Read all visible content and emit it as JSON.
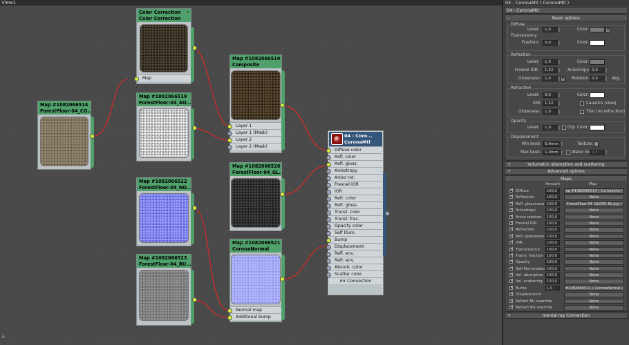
{
  "viewport": {
    "title": "View1"
  },
  "nodes": {
    "cc": {
      "line1": "Color Correction",
      "line2": "Color Correction",
      "slot": "Map"
    },
    "base": {
      "line1": "Map #1082066514",
      "line2": "ForestFloor-04_CO..."
    },
    "ao": {
      "line1": "Map #1082066519",
      "line2": "ForestFloor-04_AO..."
    },
    "nrm": {
      "line1": "Map #1082066522",
      "line2": "ForestFloor-04_NO..."
    },
    "bump": {
      "line1": "Map #1082066523",
      "line2": "ForestFloor-04_BU..."
    },
    "comp": {
      "line1": "Map #1082066514",
      "line2": "Composite",
      "slots": [
        "Layer 1",
        "Layer 1 (Mask)",
        "Layer 2",
        "Layer 2 (Mask)"
      ]
    },
    "gloss": {
      "line1": "Map #1082066520",
      "line2": "ForestFloor-04_GL..."
    },
    "cn": {
      "line1": "Map #1082066521",
      "line2": "CoronaNormal",
      "slots": [
        "Normal map",
        "Additional bump"
      ]
    },
    "mtl": {
      "line1": "04 - Coro...",
      "line2": "CoronaMtl",
      "slots": [
        "Diffuse color",
        "Refl. color",
        "Refl. gloss.",
        "Anisotropy",
        "Aniso rot.",
        "Fresnel IOR",
        "IOR",
        "Refr. color",
        "Refr. gloss.",
        "Transl. color",
        "Transl. frac.",
        "Opacity color",
        "Self Illum.",
        "Bump",
        "Displacement",
        "Refl. env.",
        "Refr. env.",
        "Absorb. color",
        "Scatter color",
        "mr Connection"
      ]
    }
  },
  "panel": {
    "title": "04 - CoronaMtl  ( CoronaMtl )",
    "name": "04 - CoronaMtl",
    "basic": "Basic options",
    "diffuse": {
      "label": "Diffuse",
      "level_lbl": "Level:",
      "level": "1,0",
      "color_lbl": "Color:",
      "m": "M",
      "transl_lbl": "Translucency",
      "fraction_lbl": "Fraction:",
      "fraction": "0,0",
      "color2_lbl": "Color:"
    },
    "reflection": {
      "label": "Reflection",
      "level_lbl": "Level:",
      "level": "1,0",
      "color_lbl": "Color:",
      "fior_lbl": "Fresnel IOR:",
      "fior": "1,52",
      "aniso_lbl": "Anisotropy:",
      "aniso": "0,0",
      "gloss_lbl": "Glossiness:",
      "gloss": "1,0",
      "m": "M",
      "rot_lbl": "Rotation:",
      "rot": "0,0",
      "deg": "deg."
    },
    "refraction": {
      "label": "Refraction",
      "level_lbl": "Level:",
      "level": "0,0",
      "color_lbl": "Color:",
      "ior_lbl": "IOR:",
      "ior": "1,52",
      "caustics": "Caustics (slow)",
      "gloss_lbl": "Glossiness:",
      "gloss": "1,0",
      "thin": "Thin (no refraction)"
    },
    "opacity": {
      "label": "Opacity",
      "level_lbl": "Level:",
      "level": "1,0",
      "clip": "Clip",
      "color_lbl": "Color:"
    },
    "displacement": {
      "label": "Displacement",
      "min_lbl": "Min level:",
      "min": "0,0mm",
      "tex_lbl": "Texture:",
      "max_lbl": "Max level:",
      "max": "1,0mm",
      "water_lbl": "Water lvl:",
      "water": "0,5"
    },
    "vol": "Volumetric absorption and scattering",
    "advanced": "Advanced options",
    "maps": "Maps",
    "amount_hdr": "Amount",
    "map_hdr": "Map",
    "rows": [
      {
        "name": "Diffuse",
        "amount": "100,0",
        "map": "ap #1082066514  ( Composite )"
      },
      {
        "name": "Reflection",
        "amount": "100,0",
        "map": "None"
      },
      {
        "name": "Refl. glossiness",
        "amount": "100,0",
        "map": "ForestFloor-04_GLOSS_8k.jpg )"
      },
      {
        "name": "Anisotropy",
        "amount": "100,0",
        "map": "None"
      },
      {
        "name": "Anisο rotation",
        "amount": "100,0",
        "map": "None"
      },
      {
        "name": "Fresnel IOR",
        "amount": "100,0",
        "map": "None"
      },
      {
        "name": "Refraction",
        "amount": "100,0",
        "map": "None"
      },
      {
        "name": "Refr. glossiness",
        "amount": "100,0",
        "map": "None"
      },
      {
        "name": "IOR",
        "amount": "100,0",
        "map": "None"
      },
      {
        "name": "Translucency",
        "amount": "100,0",
        "map": "None"
      },
      {
        "name": "Transl. fraction",
        "amount": "100,0",
        "map": "None"
      },
      {
        "name": "Opacity",
        "amount": "100,0",
        "map": "None"
      },
      {
        "name": "Self Illumination",
        "amount": "100,0",
        "map": "None"
      },
      {
        "name": "Vol. absorption",
        "amount": "100,0",
        "map": "None"
      },
      {
        "name": "Vol. scattering",
        "amount": "100,0",
        "map": "None"
      },
      {
        "name": "Bump",
        "amount": "1,0",
        "map": "#1082066521  ( CoronaNormal )"
      },
      {
        "name": "Displacement",
        "amount": "",
        "map": "None"
      },
      {
        "name": "Reflect BG override",
        "amount": "",
        "map": "None"
      },
      {
        "name": "Refract BG override",
        "amount": "",
        "map": "None"
      }
    ],
    "mr": "mental ray Connection"
  }
}
